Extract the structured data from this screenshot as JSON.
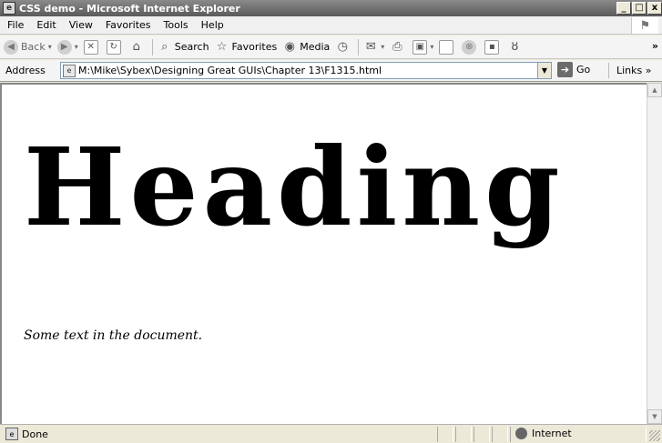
{
  "window": {
    "title": "CSS demo - Microsoft Internet Explorer",
    "controls": {
      "minimize": "_",
      "maximize": "□",
      "close": "x"
    }
  },
  "menu": {
    "items": [
      "File",
      "Edit",
      "View",
      "Favorites",
      "Tools",
      "Help"
    ]
  },
  "toolbar": {
    "back_label": "Back",
    "search_label": "Search",
    "favorites_label": "Favorites",
    "media_label": "Media",
    "more": "»"
  },
  "address": {
    "label": "Address",
    "value": "M:\\Mike\\Sybex\\Designing Great GUIs\\Chapter 13\\F1315.html",
    "go_label": "Go",
    "links_label": "Links »"
  },
  "document": {
    "heading": "Heading",
    "body_text": "Some text in the document."
  },
  "status": {
    "text": "Done",
    "zone": "Internet"
  }
}
